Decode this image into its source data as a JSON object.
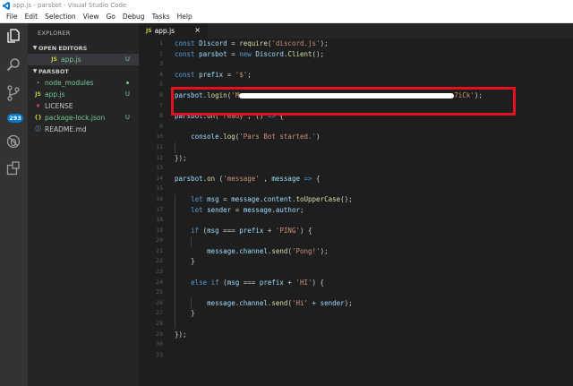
{
  "window": {
    "title": "app.js - parsbot - Visual Studio Code"
  },
  "menu": [
    "File",
    "Edit",
    "Selection",
    "View",
    "Go",
    "Debug",
    "Tasks",
    "Help"
  ],
  "activity": {
    "icons": [
      "files-icon",
      "search-icon",
      "source-control-icon",
      "debug-icon",
      "extensions-icon"
    ],
    "scm_badge": "293"
  },
  "sidebar": {
    "title": "EXPLORER",
    "open_editors": {
      "label": "OPEN EDITORS",
      "items": [
        {
          "icon": "JS",
          "name": "app.js",
          "status": "U"
        }
      ]
    },
    "project": {
      "label": "PARSBOT",
      "items": [
        {
          "icon": "›",
          "name": "node_modules",
          "status": ""
        },
        {
          "icon": "JS",
          "name": "app.js",
          "status": "U"
        },
        {
          "icon": "♦",
          "name": "LICENSE",
          "status": ""
        },
        {
          "icon": "{}",
          "name": "package-lock.json",
          "status": "U"
        },
        {
          "icon": "ⓘ",
          "name": "README.md",
          "status": ""
        }
      ]
    }
  },
  "tab": {
    "icon": "JS",
    "label": "app.js",
    "close": "×"
  },
  "editor": {
    "line_numbers": [
      "1",
      "2",
      "3",
      "4",
      "5",
      "6",
      "7",
      "8",
      "9",
      "10",
      "11",
      "12",
      "13",
      "14",
      "15",
      "16",
      "17",
      "18",
      "19",
      "20",
      "21",
      "22",
      "23",
      "24",
      "25",
      "26",
      "27",
      "28",
      "29",
      "30",
      "31"
    ],
    "lines": [
      [
        [
          "c-key",
          "const "
        ],
        [
          "c-var",
          "Discord"
        ],
        [
          "c-pl",
          " = "
        ],
        [
          "c-fn",
          "require"
        ],
        [
          "c-pl",
          "("
        ],
        [
          "c-str",
          "'discord.js'"
        ],
        [
          "c-pl",
          ");"
        ]
      ],
      [
        [
          "c-key",
          "const "
        ],
        [
          "c-var",
          "parsbot"
        ],
        [
          "c-pl",
          " = "
        ],
        [
          "c-key",
          "new "
        ],
        [
          "c-var",
          "Discord"
        ],
        [
          "c-pl",
          "."
        ],
        [
          "c-fn",
          "Client"
        ],
        [
          "c-pl",
          "();"
        ]
      ],
      [],
      [
        [
          "c-key",
          "const "
        ],
        [
          "c-var",
          "prefix"
        ],
        [
          "c-pl",
          " = "
        ],
        [
          "c-str",
          "'$'"
        ],
        [
          "c-pl",
          ";"
        ]
      ],
      [],
      [
        [
          "c-var",
          "parsbot"
        ],
        [
          "c-pl",
          "."
        ],
        [
          "c-fn",
          "login"
        ],
        [
          "c-pl",
          "("
        ],
        [
          "c-str",
          "'M"
        ],
        [
          "redact",
          "240"
        ],
        [
          "c-str",
          "7iCk'"
        ],
        [
          "c-pl",
          ");"
        ]
      ],
      [],
      [
        [
          "c-var",
          "parsbot"
        ],
        [
          "c-pl",
          "."
        ],
        [
          "c-fn",
          "on"
        ],
        [
          "c-pl",
          "("
        ],
        [
          "c-str",
          "'ready'"
        ],
        [
          "c-pl",
          ", () "
        ],
        [
          "c-key",
          "=>"
        ],
        [
          "c-pl",
          " {"
        ]
      ],
      [],
      [
        [
          "c-pl",
          "    "
        ],
        [
          "c-var",
          "console"
        ],
        [
          "c-pl",
          "."
        ],
        [
          "c-fn",
          "log"
        ],
        [
          "c-pl",
          "("
        ],
        [
          "c-str",
          "'Pars Bot started.'"
        ],
        [
          "c-pl",
          ")"
        ]
      ],
      [],
      [
        [
          "c-pl",
          "});"
        ]
      ],
      [],
      [
        [
          "c-var",
          "parsbot"
        ],
        [
          "c-pl",
          "."
        ],
        [
          "c-fn",
          "on"
        ],
        [
          "c-pl",
          " ("
        ],
        [
          "c-str",
          "'message'"
        ],
        [
          "c-pl",
          " , "
        ],
        [
          "c-var",
          "message"
        ],
        [
          "c-pl",
          " "
        ],
        [
          "c-key",
          "=>"
        ],
        [
          "c-pl",
          " {"
        ]
      ],
      [],
      [
        [
          "c-pl",
          "    "
        ],
        [
          "c-key",
          "let "
        ],
        [
          "c-var",
          "msg"
        ],
        [
          "c-pl",
          " = "
        ],
        [
          "c-var",
          "message"
        ],
        [
          "c-pl",
          "."
        ],
        [
          "c-var",
          "content"
        ],
        [
          "c-pl",
          "."
        ],
        [
          "c-fn",
          "toUpperCase"
        ],
        [
          "c-pl",
          "();"
        ]
      ],
      [
        [
          "c-pl",
          "    "
        ],
        [
          "c-key",
          "let "
        ],
        [
          "c-var",
          "sender"
        ],
        [
          "c-pl",
          " = "
        ],
        [
          "c-var",
          "message"
        ],
        [
          "c-pl",
          "."
        ],
        [
          "c-var",
          "author"
        ],
        [
          "c-pl",
          ";"
        ]
      ],
      [],
      [
        [
          "c-pl",
          "    "
        ],
        [
          "c-key",
          "if"
        ],
        [
          "c-pl",
          " ("
        ],
        [
          "c-var",
          "msg"
        ],
        [
          "c-pl",
          " === "
        ],
        [
          "c-var",
          "prefix"
        ],
        [
          "c-pl",
          " + "
        ],
        [
          "c-str",
          "'PING'"
        ],
        [
          "c-pl",
          ") {"
        ]
      ],
      [],
      [
        [
          "c-pl",
          "        "
        ],
        [
          "c-var",
          "message"
        ],
        [
          "c-pl",
          "."
        ],
        [
          "c-var",
          "channel"
        ],
        [
          "c-pl",
          "."
        ],
        [
          "c-fn",
          "send"
        ],
        [
          "c-pl",
          "("
        ],
        [
          "c-str",
          "'Pong!'"
        ],
        [
          "c-pl",
          ");"
        ]
      ],
      [
        [
          "c-pl",
          "    }"
        ]
      ],
      [],
      [
        [
          "c-pl",
          "    "
        ],
        [
          "c-key",
          "else if"
        ],
        [
          "c-pl",
          " ("
        ],
        [
          "c-var",
          "msg"
        ],
        [
          "c-pl",
          " === "
        ],
        [
          "c-var",
          "prefix"
        ],
        [
          "c-pl",
          " + "
        ],
        [
          "c-str",
          "'HI'"
        ],
        [
          "c-pl",
          ") {"
        ]
      ],
      [],
      [
        [
          "c-pl",
          "        "
        ],
        [
          "c-var",
          "message"
        ],
        [
          "c-pl",
          "."
        ],
        [
          "c-var",
          "channel"
        ],
        [
          "c-pl",
          "."
        ],
        [
          "c-fn",
          "send"
        ],
        [
          "c-pl",
          "("
        ],
        [
          "c-str",
          "'Hi'"
        ],
        [
          "c-pl",
          " + "
        ],
        [
          "c-var",
          "sender"
        ],
        [
          "c-pl",
          ");"
        ]
      ],
      [
        [
          "c-pl",
          "    }"
        ]
      ],
      [],
      [
        [
          "c-pl",
          "});"
        ]
      ],
      [],
      []
    ]
  }
}
